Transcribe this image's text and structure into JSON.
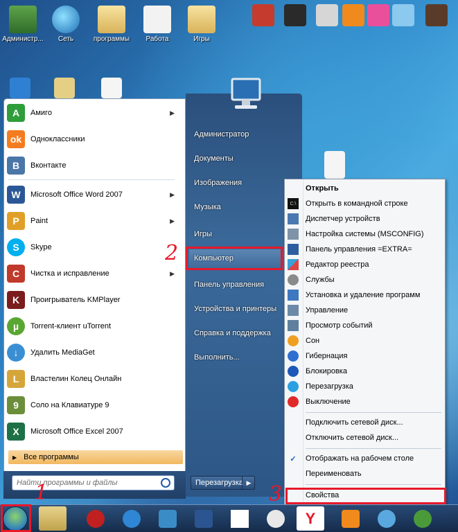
{
  "desktop_icons": [
    {
      "label": "Администр...",
      "icon": "user-icon"
    },
    {
      "label": "Сеть",
      "icon": "network-icon"
    },
    {
      "label": "программы",
      "icon": "folder-icon"
    },
    {
      "label": "Работа",
      "icon": "folder-icon"
    },
    {
      "label": "Игры",
      "icon": "folder-icon"
    }
  ],
  "start_menu": {
    "programs": [
      {
        "label": "Амиго",
        "icon": "amigo-icon",
        "color": "#2e9d3a",
        "glyph": "A",
        "arrow": true
      },
      {
        "label": "Одноклассники",
        "icon": "odnoklassniki-icon",
        "color": "#f47c20",
        "glyph": "ok",
        "arrow": false
      },
      {
        "label": "Вконтакте",
        "icon": "vk-icon",
        "color": "#4a76a8",
        "glyph": "B",
        "arrow": false
      },
      {
        "label": "Microsoft Office Word 2007",
        "icon": "word-icon",
        "color": "#2b5797",
        "glyph": "W",
        "arrow": true
      },
      {
        "label": "Paint",
        "icon": "paint-icon",
        "color": "#e0a028",
        "glyph": "P",
        "arrow": true
      },
      {
        "label": "Skype",
        "icon": "skype-icon",
        "color": "#00aff0",
        "glyph": "S",
        "arrow": false
      },
      {
        "label": "Чистка и исправление",
        "icon": "cleaner-icon",
        "color": "#c0392b",
        "glyph": "C",
        "arrow": true
      },
      {
        "label": "Проигрыватель KMPlayer",
        "icon": "kmplayer-icon",
        "color": "#7a1d1d",
        "glyph": "K",
        "arrow": false
      },
      {
        "label": "Torrent-клиент uTorrent",
        "icon": "utorrent-icon",
        "color": "#5aa632",
        "glyph": "µ",
        "arrow": false
      },
      {
        "label": "Удалить MediaGet",
        "icon": "uninstall-icon",
        "color": "#3a8fd4",
        "glyph": "↓",
        "arrow": false
      },
      {
        "label": "Властелин Колец Онлайн",
        "icon": "lotro-icon",
        "color": "#d6a53a",
        "glyph": "L",
        "arrow": false
      },
      {
        "label": "Соло на Клавиатуре 9",
        "icon": "solo-icon",
        "color": "#6b8e3a",
        "glyph": "9",
        "arrow": false
      },
      {
        "label": "Microsoft Office Excel 2007",
        "icon": "excel-icon",
        "color": "#1e7145",
        "glyph": "X",
        "arrow": false
      }
    ],
    "all_programs_label": "Все программы",
    "search_placeholder": "Найти программы и файлы",
    "right_items": [
      "Администратор",
      "Документы",
      "Изображения",
      "Музыка",
      "Игры",
      "Компьютер",
      "Панель управления",
      "Устройства и принтеры",
      "Справка и поддержка",
      "Выполнить..."
    ],
    "shutdown_label": "Перезагрузка"
  },
  "context_menu": {
    "items": [
      {
        "label": "Открыть",
        "icon": "none",
        "bold": true
      },
      {
        "label": "Открыть в командной строке",
        "icon": "cmd-icon"
      },
      {
        "label": "Диспетчер устройств",
        "icon": "device-manager-icon"
      },
      {
        "label": "Настройка системы (MSCONFIG)",
        "icon": "msconfig-icon"
      },
      {
        "label": "Панель управления =EXTRA=",
        "icon": "control-panel-icon"
      },
      {
        "label": "Редактор реестра",
        "icon": "regedit-icon"
      },
      {
        "label": "Службы",
        "icon": "services-icon"
      },
      {
        "label": "Установка и удаление программ",
        "icon": "programs-icon"
      },
      {
        "label": "Управление",
        "icon": "management-icon"
      },
      {
        "label": "Просмотр событий",
        "icon": "eventvwr-icon"
      },
      {
        "label": "Сон",
        "icon": "sleep-icon"
      },
      {
        "label": "Гибернация",
        "icon": "hibernate-icon"
      },
      {
        "label": "Блокировка",
        "icon": "lock-icon"
      },
      {
        "label": "Перезагрузка",
        "icon": "restart-icon"
      },
      {
        "label": "Выключение",
        "icon": "shutdown-icon"
      }
    ],
    "items2": [
      {
        "label": "Подключить сетевой диск..."
      },
      {
        "label": "Отключить сетевой диск..."
      }
    ],
    "items3": [
      {
        "label": "Отображать на рабочем столе",
        "checked": true
      },
      {
        "label": "Переименовать",
        "checked": false
      }
    ],
    "properties_label": "Свойства"
  },
  "annotations": [
    "1",
    "2",
    "3"
  ],
  "colors": {
    "annotation": "#e8182a",
    "accent": "#2b4f7c"
  }
}
